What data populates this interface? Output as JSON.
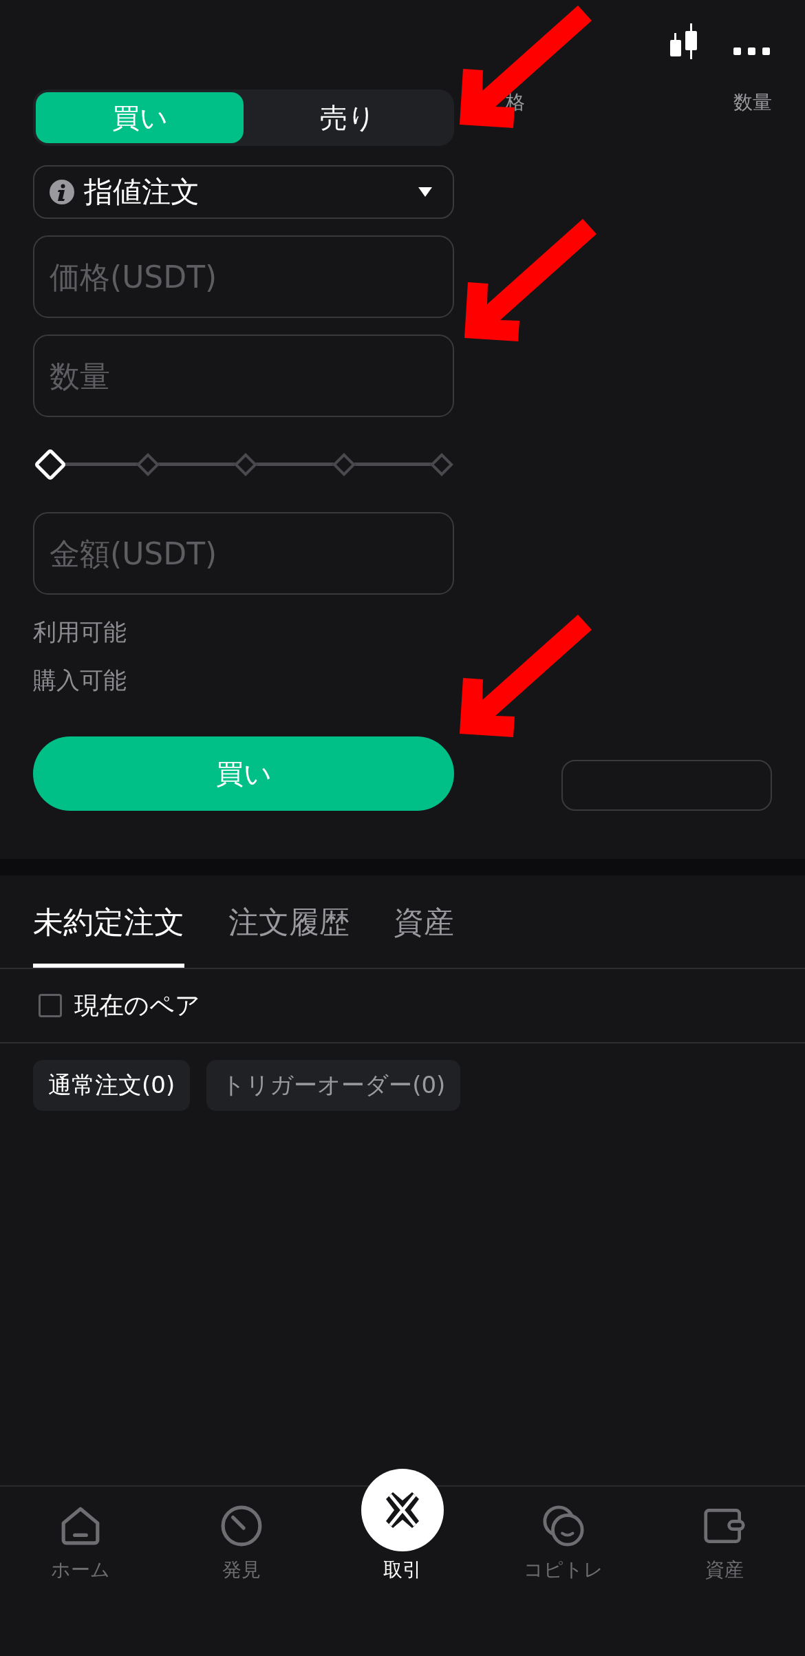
{
  "orderbook_header": [
    "格",
    "数量"
  ],
  "side_tabs": [
    {
      "label": "買い",
      "selected": true
    },
    {
      "label": "売り",
      "selected": false
    }
  ],
  "order_type": {
    "label": "指値注文"
  },
  "fields": [
    {
      "placeholder": "価格(USDT)"
    },
    {
      "placeholder": "数量"
    }
  ],
  "slider": {
    "level": 0
  },
  "amount_field": {
    "placeholder": "金額(USDT)"
  },
  "info_lines": [
    "利用可能",
    "購入可能"
  ],
  "submit_button": "買い",
  "orders_tabs": [
    {
      "label": "未約定注文",
      "selected": true
    },
    {
      "label": "注文履歴",
      "selected": false
    },
    {
      "label": "資産",
      "selected": false
    }
  ],
  "current_pair": {
    "label": "現在のペア",
    "checked": false
  },
  "order_filters": [
    {
      "label": "通常注文(0)",
      "selected": true
    },
    {
      "label": "トリガーオーダー(0)",
      "selected": false
    }
  ],
  "nav": [
    {
      "kind": "home",
      "label": "ホーム",
      "selected": false
    },
    {
      "kind": "discover",
      "label": "発見",
      "selected": false
    },
    {
      "kind": "trade",
      "label": "取引",
      "selected": true
    },
    {
      "kind": "copy",
      "label": "コピトレ",
      "selected": false
    },
    {
      "kind": "wallet",
      "label": "資産",
      "selected": false
    }
  ]
}
